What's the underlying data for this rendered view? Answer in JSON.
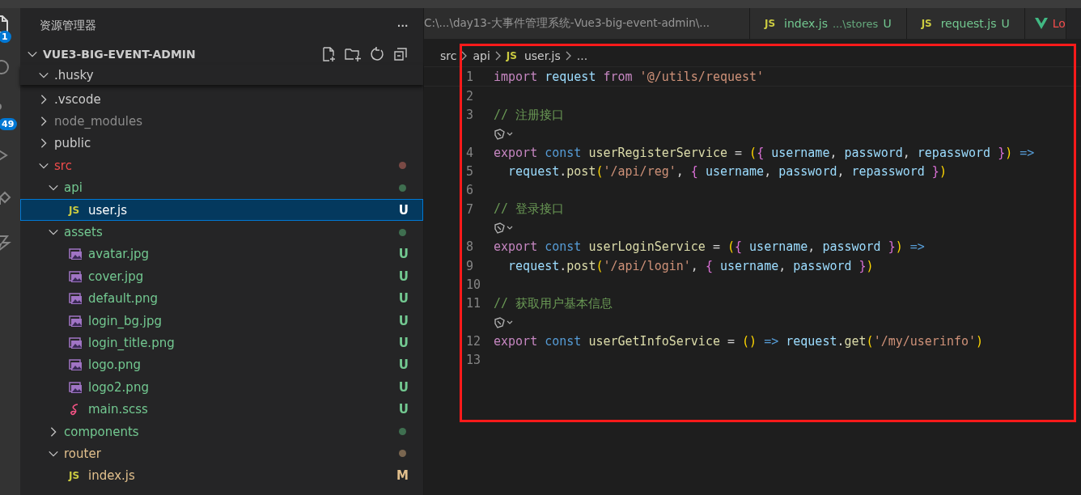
{
  "activity_bar": {
    "badges": [
      {
        "kind": "files",
        "count": "1"
      },
      {
        "kind": "search"
      },
      {
        "kind": "source",
        "count": "49"
      },
      {
        "kind": "run"
      },
      {
        "kind": "extensions"
      },
      {
        "kind": "remote"
      }
    ]
  },
  "sidebar": {
    "title": "资源管理器",
    "more": "···",
    "root": {
      "name": "VUE3-BIG-EVENT-ADMIN",
      "expanded": true
    },
    "items": [
      {
        "name": ".husky",
        "kind": "folder",
        "expanded": true,
        "color": "#cccccc",
        "sticky": true
      },
      {
        "name": ".vscode",
        "kind": "folder",
        "expanded": false,
        "color": "#cccccc"
      },
      {
        "name": "node_modules",
        "kind": "folder",
        "expanded": false,
        "color": "#8c8c8c"
      },
      {
        "name": "public",
        "kind": "folder",
        "expanded": false,
        "color": "#cccccc"
      },
      {
        "name": "src",
        "kind": "folder",
        "expanded": true,
        "color": "#f14c4c",
        "dot": {
          "color": "#7a4a45"
        },
        "children": [
          {
            "name": "api",
            "kind": "folder",
            "expanded": true,
            "color": "#73c991",
            "dot": {
              "color": "#3f6f50"
            },
            "children": [
              {
                "name": "user.js",
                "kind": "js",
                "icon": "JS",
                "color": "#ffffff",
                "badge": "U",
                "selected": true
              }
            ]
          },
          {
            "name": "assets",
            "kind": "folder",
            "expanded": true,
            "color": "#73c991",
            "dot": {
              "color": "#3f6f50"
            },
            "children": [
              {
                "name": "avatar.jpg",
                "kind": "image",
                "color": "#73c991",
                "badge": "U",
                "selected": false
              },
              {
                "name": "cover.jpg",
                "kind": "image",
                "color": "#73c991",
                "badge": "U",
                "selected": false
              },
              {
                "name": "default.png",
                "kind": "image",
                "color": "#73c991",
                "badge": "U",
                "selected": false
              },
              {
                "name": "login_bg.jpg",
                "kind": "image",
                "color": "#73c991",
                "badge": "U",
                "selected": false
              },
              {
                "name": "login_title.png",
                "kind": "image",
                "color": "#73c991",
                "badge": "U",
                "selected": false
              },
              {
                "name": "logo.png",
                "kind": "image",
                "color": "#73c991",
                "badge": "U",
                "selected": false
              },
              {
                "name": "logo2.png",
                "kind": "image",
                "color": "#73c991",
                "badge": "U",
                "selected": false
              },
              {
                "name": "main.scss",
                "kind": "scss",
                "color": "#73c991",
                "badge": "U",
                "selected": false
              }
            ]
          },
          {
            "name": "components",
            "kind": "folder",
            "expanded": false,
            "color": "#73c991",
            "dot": {
              "color": "#3f6f50"
            }
          },
          {
            "name": "router",
            "kind": "folder",
            "expanded": true,
            "color": "#e2c08d",
            "dot": {
              "color": "#7a6650"
            },
            "children": [
              {
                "name": "index.js",
                "kind": "js",
                "icon": "JS",
                "color": "#e2c08d",
                "badge": "M",
                "selected": false
              }
            ]
          }
        ]
      }
    ]
  },
  "tabs": [
    {
      "kind": "path",
      "label": "C:\\...\\day13-大事件管理系统-Vue3-big-event-admin\\..."
    },
    {
      "kind": "js",
      "icon": "JS",
      "label": "index.js",
      "description": "...\\stores",
      "badge": "U"
    },
    {
      "kind": "js",
      "icon": "JS",
      "label": "request.js",
      "badge": "U"
    },
    {
      "kind": "vue",
      "label": "Lo"
    }
  ],
  "breadcrumb": [
    {
      "label": "src"
    },
    {
      "label": "api"
    },
    {
      "label": "user.js",
      "icon": "JS"
    },
    {
      "label": "..."
    }
  ],
  "code": [
    {
      "number": "1",
      "tokens": [
        {
          "t": "import",
          "kind": "kw"
        },
        {
          "t": " request",
          "kind": "var"
        },
        {
          "t": " from",
          "kind": "kw"
        },
        {
          "t": " '@/utils/request'",
          "kind": "str"
        }
      ]
    },
    {
      "number": "2"
    },
    {
      "number": "3",
      "tokens": [
        {
          "t": "// 注册接口",
          "kind": "cm"
        }
      ]
    },
    {
      "kind": "lens"
    },
    {
      "number": "4",
      "tokens": [
        {
          "t": "export",
          "kind": "kw"
        },
        {
          "t": " const",
          "kind": "decl"
        },
        {
          "t": " userRegisterService",
          "kind": "fn"
        },
        {
          "t": " =",
          "kind": "op"
        },
        {
          "t": " (",
          "kind": "br1"
        },
        {
          "t": "{",
          "kind": "br2"
        },
        {
          "t": " username",
          "kind": "var"
        },
        {
          "t": ",",
          "kind": "op"
        },
        {
          "t": " password",
          "kind": "var"
        },
        {
          "t": ",",
          "kind": "op"
        },
        {
          "t": " repassword",
          "kind": "var"
        },
        {
          "t": " }",
          "kind": "br2"
        },
        {
          "t": ")",
          "kind": "br1"
        },
        {
          "t": " =>",
          "kind": "decl"
        }
      ]
    },
    {
      "number": "5",
      "tokens": [
        {
          "t": "  request",
          "kind": "var"
        },
        {
          "t": ".",
          "kind": "op"
        },
        {
          "t": "post",
          "kind": "fn"
        },
        {
          "t": "(",
          "kind": "br1"
        },
        {
          "t": "'/api/reg'",
          "kind": "str"
        },
        {
          "t": ",",
          "kind": "op"
        },
        {
          "t": " {",
          "kind": "br2"
        },
        {
          "t": " username",
          "kind": "var"
        },
        {
          "t": ",",
          "kind": "op"
        },
        {
          "t": " password",
          "kind": "var"
        },
        {
          "t": ",",
          "kind": "op"
        },
        {
          "t": " repassword",
          "kind": "var"
        },
        {
          "t": " }",
          "kind": "br2"
        },
        {
          "t": ")",
          "kind": "br1"
        }
      ]
    },
    {
      "number": "6"
    },
    {
      "number": "7",
      "tokens": [
        {
          "t": "// 登录接口",
          "kind": "cm"
        }
      ]
    },
    {
      "kind": "lens"
    },
    {
      "number": "8",
      "tokens": [
        {
          "t": "export",
          "kind": "kw"
        },
        {
          "t": " const",
          "kind": "decl"
        },
        {
          "t": " userLoginService",
          "kind": "fn"
        },
        {
          "t": " =",
          "kind": "op"
        },
        {
          "t": " (",
          "kind": "br1"
        },
        {
          "t": "{",
          "kind": "br2"
        },
        {
          "t": " username",
          "kind": "var"
        },
        {
          "t": ",",
          "kind": "op"
        },
        {
          "t": " password",
          "kind": "var"
        },
        {
          "t": " }",
          "kind": "br2"
        },
        {
          "t": ")",
          "kind": "br1"
        },
        {
          "t": " =>",
          "kind": "decl"
        }
      ]
    },
    {
      "number": "9",
      "tokens": [
        {
          "t": "  request",
          "kind": "var"
        },
        {
          "t": ".",
          "kind": "op"
        },
        {
          "t": "post",
          "kind": "fn"
        },
        {
          "t": "(",
          "kind": "br1"
        },
        {
          "t": "'/api/login'",
          "kind": "str"
        },
        {
          "t": ",",
          "kind": "op"
        },
        {
          "t": " {",
          "kind": "br2"
        },
        {
          "t": " username",
          "kind": "var"
        },
        {
          "t": ",",
          "kind": "op"
        },
        {
          "t": " password",
          "kind": "var"
        },
        {
          "t": " }",
          "kind": "br2"
        },
        {
          "t": ")",
          "kind": "br1"
        }
      ]
    },
    {
      "number": "10"
    },
    {
      "number": "11",
      "tokens": [
        {
          "t": "// 获取用户基本信息",
          "kind": "cm"
        }
      ]
    },
    {
      "kind": "lens"
    },
    {
      "number": "12",
      "tokens": [
        {
          "t": "export",
          "kind": "kw"
        },
        {
          "t": " const",
          "kind": "decl"
        },
        {
          "t": " userGetInfoService",
          "kind": "fn"
        },
        {
          "t": " =",
          "kind": "op"
        },
        {
          "t": " ()",
          "kind": "br1"
        },
        {
          "t": " =>",
          "kind": "decl"
        },
        {
          "t": " request",
          "kind": "var"
        },
        {
          "t": ".",
          "kind": "op"
        },
        {
          "t": "get",
          "kind": "fn"
        },
        {
          "t": "(",
          "kind": "br1"
        },
        {
          "t": "'/my/userinfo'",
          "kind": "str"
        },
        {
          "t": ")",
          "kind": "br1"
        }
      ]
    },
    {
      "number": "13"
    }
  ]
}
